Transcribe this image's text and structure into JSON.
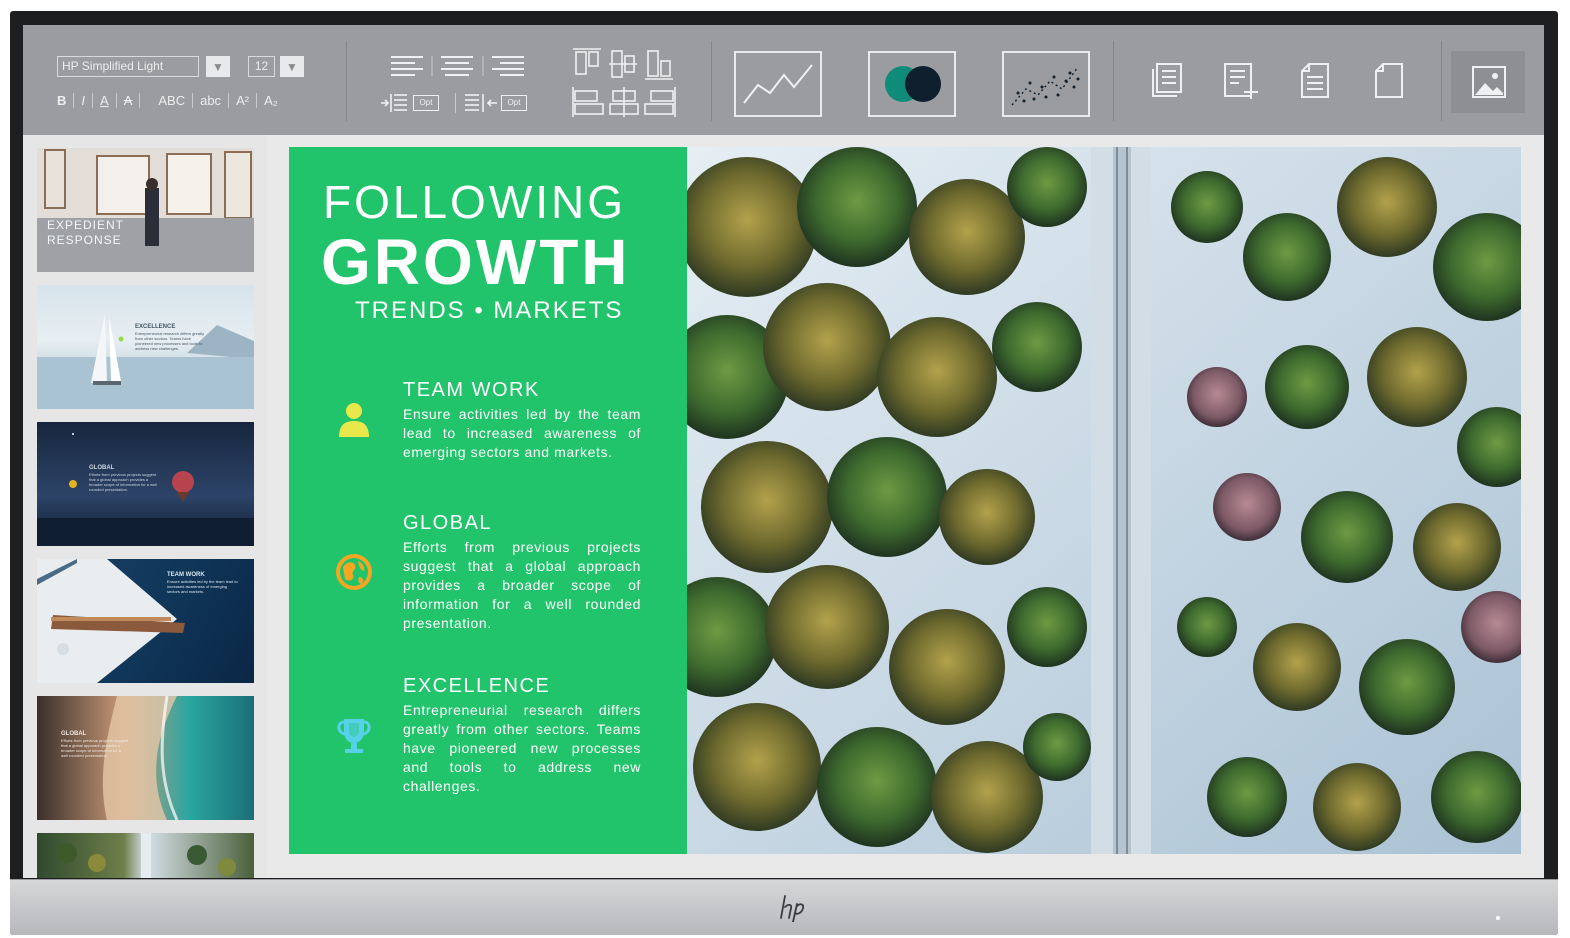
{
  "toolbar": {
    "font_name": "HP Simplified Light",
    "font_size": "12",
    "bold": "B",
    "italic": "I",
    "underline": "A",
    "strikethrough": "A",
    "uppercase": "ABC",
    "lowercase": "abc",
    "superscript": "A²",
    "subscript": "A₂",
    "option_label": "Opt",
    "option_label_right": "Opt"
  },
  "thumbnails": {
    "slide1": {
      "title_line1": "EXPEDIENT",
      "title_line2": "RESPONSE"
    },
    "slide2": {
      "heading": "EXCELLENCE",
      "text": "Entrepreneurial research differs greatly from other sectors. Teams have pioneered new processes and tools to address new challenges."
    },
    "slide3": {
      "heading": "GLOBAL",
      "text": "Efforts from previous projects suggest that a global approach provides a broader scope of information for a well rounded presentation."
    },
    "slide4": {
      "heading": "TEAM WORK",
      "text": "Ensure activities led by the team lead to increased awareness of emerging sectors and markets."
    },
    "slide5": {
      "heading": "GLOBAL",
      "text": "Efforts from previous projects suggest that a global approach provides a broader scope of information for a well rounded presentation."
    }
  },
  "slide": {
    "title_line1": "FOLLOWING",
    "title_line2": "GROWTH",
    "subtitle": "TRENDS • MARKETS",
    "features": [
      {
        "heading": "TEAM WORK",
        "text": "Ensure activities led by the team lead to increased awareness of emerging sectors and markets.",
        "icon": "person-icon"
      },
      {
        "heading": "GLOBAL",
        "text": "Efforts from previous projects suggest that a global approach provides a broader scope of information for a well rounded presentation.",
        "icon": "globe-icon"
      },
      {
        "heading": "EXCELLENCE",
        "text": "Entrepreneurial research differs greatly from other sectors. Teams have pioneered new processes and tools to address new challenges.",
        "icon": "trophy-icon"
      }
    ]
  },
  "colors": {
    "slide_green": "#21c46a",
    "ribbon": "#9b9c9f",
    "icon_yellow": "#e8e84a",
    "icon_orange": "#f5a623",
    "icon_cyan": "#55d1e8"
  }
}
